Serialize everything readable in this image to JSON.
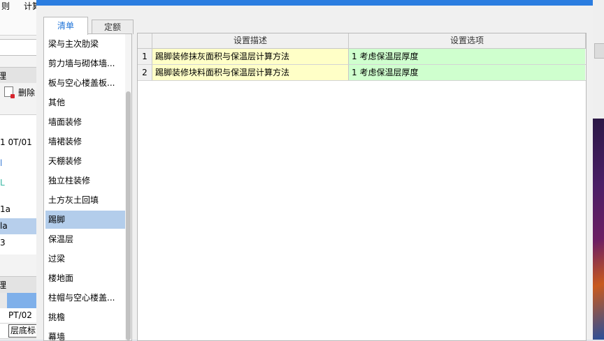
{
  "background_app": {
    "menu_items": [
      "则",
      "计算"
    ],
    "panel_header_1": "理",
    "delete_label": "删除",
    "tree_items": [
      "1 0T/01",
      "l",
      "L",
      "1a",
      "la",
      "3"
    ],
    "tree_selected_index": 4,
    "panel_header_2": "理",
    "grid_cells": [
      "PT/02",
      "层底标"
    ]
  },
  "dialog": {
    "tabs": [
      {
        "label": "清单",
        "active": true
      },
      {
        "label": "定额",
        "active": false
      }
    ],
    "category_list": {
      "items": [
        "梁与主次肋梁",
        "剪力墙与砌体墙...",
        "板与空心楼盖板...",
        "其他",
        "墙面装修",
        "墙裙装修",
        "天棚装修",
        "独立柱装修",
        "土方灰土回填",
        "踢脚",
        "保温层",
        "过梁",
        "楼地面",
        "柱帽与空心楼盖...",
        "挑檐",
        "幕墙"
      ],
      "selected_index": 9
    },
    "grid": {
      "columns": [
        "设置描述",
        "设置选项"
      ],
      "rows": [
        {
          "num": "1",
          "description": "踢脚装修抹灰面积与保温层计算方法",
          "option": "1 考虑保温层厚度"
        },
        {
          "num": "2",
          "description": "踢脚装修块料面积与保温层计算方法",
          "option": "1 考虑保温层厚度"
        }
      ]
    }
  },
  "colors": {
    "title_bar": "#2b7de0",
    "active_tab_text": "#1e73d8",
    "selected_item": "#b3cdeb",
    "desc_cell_bg": "#ffffc7",
    "option_cell_bg": "#cfffce"
  }
}
